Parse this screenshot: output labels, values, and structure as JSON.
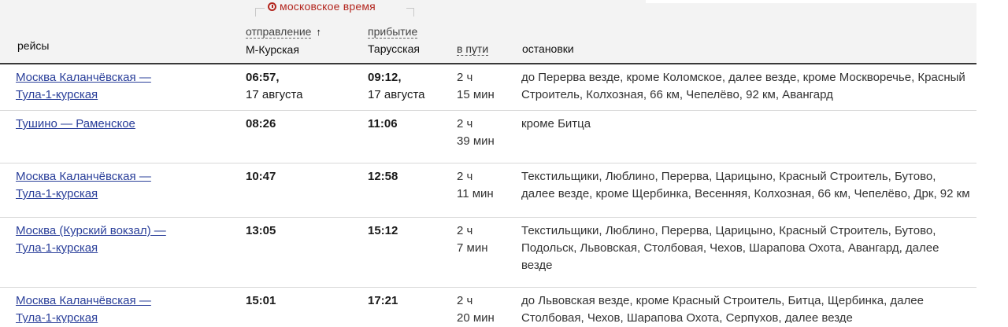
{
  "legend": {
    "time_label": "московское время"
  },
  "header": {
    "routes": "рейсы",
    "departure_label": "отправление",
    "departure_sort_arrow": "↑",
    "departure_station": "М-Курская",
    "arrival_label": "прибытие",
    "arrival_station": "Тарусская",
    "travel_time": "в пути",
    "stops": "остановки"
  },
  "rows": [
    {
      "route_line1": "Москва Каланчёвская —",
      "route_line2": "Тула-1-курская",
      "dep_time": "06:57,",
      "dep_date": "17 августа",
      "arr_time": "09:12,",
      "arr_date": "17 августа",
      "travel_line1": "2 ч",
      "travel_line2": "15 мин",
      "stops": "до Перерва везде, кроме Коломское, далее везде, кроме Москворечье, Красный Строитель, Колхозная, 66 км, Чепелёво, 92 км, Авангард"
    },
    {
      "route_line1": "Тушино — Раменское",
      "route_line2": "",
      "dep_time": "08:26",
      "dep_date": "",
      "arr_time": "11:06",
      "arr_date": "",
      "travel_line1": "2 ч",
      "travel_line2": "39 мин",
      "stops": "кроме Битца"
    },
    {
      "route_line1": "Москва Каланчёвская —",
      "route_line2": "Тула-1-курская",
      "dep_time": "10:47",
      "dep_date": "",
      "arr_time": "12:58",
      "arr_date": "",
      "travel_line1": "2 ч",
      "travel_line2": "11 мин",
      "stops": "Текстильщики, Люблино, Перерва, Царицыно, Красный Строитель, Бутово, далее везде, кроме Щербинка, Весенняя, Колхозная, 66 км, Чепелёво, Дрк, 92 км"
    },
    {
      "route_line1": "Москва (Курский вокзал) —",
      "route_line2": "Тула-1-курская",
      "dep_time": "13:05",
      "dep_date": "",
      "arr_time": "15:12",
      "arr_date": "",
      "travel_line1": "2 ч",
      "travel_line2": "7 мин",
      "stops": "Текстильщики, Люблино, Перерва, Царицыно, Красный Строитель, Бутово, Подольск, Львовская, Столбовая, Чехов, Шарапова Охота, Авангард, далее везде"
    },
    {
      "route_line1": "Москва Каланчёвская —",
      "route_line2": "Тула-1-курская",
      "dep_time": "15:01",
      "dep_date": "",
      "arr_time": "17:21",
      "arr_date": "",
      "travel_line1": "2 ч",
      "travel_line2": "20 мин",
      "stops": "до Львовская везде, кроме Красный Строитель, Битца, Щербинка, далее Столбовая, Чехов, Шарапова Охота, Серпухов, далее везде"
    }
  ]
}
